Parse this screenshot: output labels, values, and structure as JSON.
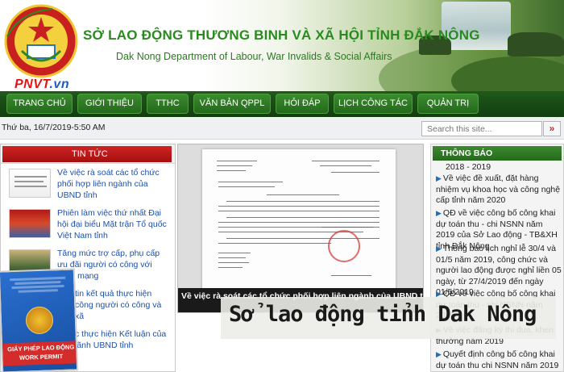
{
  "header": {
    "title": "SỞ LAO ĐỘNG THƯƠNG BINH VÀ XÃ HỘI TỈNH ĐẮK NÔNG",
    "subtitle": "Dak Nong Department of Labour, War Invalids & Social Affairs",
    "watermark_logo": "PNVT",
    "watermark_suffix": ".vn"
  },
  "nav": {
    "items": [
      "TRANG CHỦ",
      "GIỚI THIỆU",
      "TTHC",
      "VĂN BẢN QPPL",
      "HỎI ĐÁP",
      "LỊCH CÔNG TÁC",
      "QUẢN TRỊ"
    ]
  },
  "toolbar": {
    "date": "Thứ ba, 16/7/2019-5:50 AM",
    "search_placeholder": "Search this site...",
    "search_button": "»"
  },
  "news": {
    "heading": "TIN TỨC",
    "items": [
      {
        "title": "Về việc rà soát các tổ chức phối hợp liên ngành của UBND tỉnh"
      },
      {
        "title": "Phiên làm việc thứ nhất Đại hội đại biểu Mặt trận Tổ quốc Việt Nam tỉnh"
      },
      {
        "title": "Tăng mức trợ cấp, phụ cấp ưu đãi người có công với cách mạng"
      },
      {
        "title": "tin kết quả thực hiện công người có công và xã"
      },
      {
        "title": "c thực hiện Kết luận của lãnh UBND tỉnh"
      }
    ]
  },
  "featured": {
    "caption": "Về việc rà soát các tổ chức phối hợp liên ngành của UBND tỉnh"
  },
  "notices": {
    "heading": "THÔNG BÁO",
    "items": [
      "2018 - 2019",
      "Về việc đề xuất, đặt hàng nhiệm vụ khoa học và công nghệ cấp tỉnh năm 2020",
      "QĐ về việc công bố công khai dự toán thu - chi NSNN năm 2019 của Sở Lao động - TB&XH tỉnh Đắk Nông",
      "Thông báo lịch nghỉ lễ 30/4 và 01/5 năm 2019, công chức và người lao động được nghỉ liền 05 ngày, từ 27/4/2019 đến ngày 01/5/2019",
      "QĐ về việc công bố công khai dự toán thu - chi NSNN năm 2019",
      "Về việc đăng ký thi đua, khen thưởng năm 2019",
      "Quyết định công bố công khai dự toán thu chi NSNN năm 2019 của"
    ]
  },
  "overlay": {
    "text": "Sở lao động tỉnh Dak Nông"
  },
  "permit": {
    "title_line1": "GIẤY PHÉP LAO ĐỘNG",
    "title_line2": "WORK PERMIT"
  },
  "colors": {
    "brand_green": "#2a8a1f",
    "nav_green": "#23681c",
    "news_red": "#c31a1a",
    "link_blue": "#1e4fa8"
  }
}
